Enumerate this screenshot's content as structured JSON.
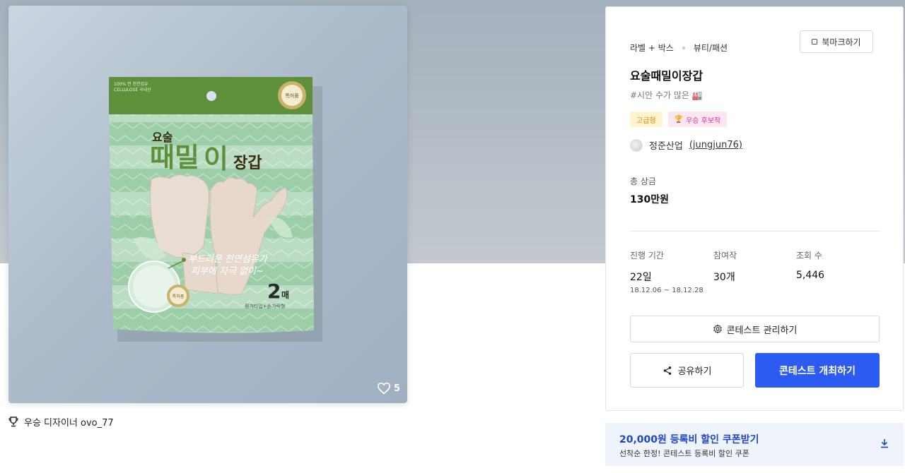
{
  "gallery": {
    "package_texts": {
      "fiber_note": "100% 면 천연섬유",
      "fiber_note_en": "CELLULOSE 국내산",
      "seal": "특허품",
      "brand_small": "요술",
      "brand_big1": "때밀",
      "brand_big2": "이",
      "brand_big3": "장갑",
      "slogan1": "부드러운 천연섬유가",
      "slogan2": "피부에 자극 없이~",
      "count": "2",
      "count_unit": "매",
      "bottom_note": "핑거타입+손가락형"
    },
    "likes": "5",
    "winner_text": "우승 디자이너 ovo_77"
  },
  "contest": {
    "breadcrumb": [
      "라벨 + 박스",
      "뷰티/패션"
    ],
    "bookmark_label": "북마크하기",
    "title": "요술때밀이장갑",
    "tagline": "#시안 수가 많은 🏭",
    "badges": [
      {
        "label": "고급형"
      },
      {
        "label": "우승 후보작"
      }
    ],
    "owner_name": "정준산업",
    "owner_handle": "(jungjun76)",
    "prize_label": "총 상금",
    "prize_value": "130만원",
    "stats": [
      {
        "label": "진행 기간",
        "value": "22일",
        "sub": "18.12.06 ~ 18.12.28"
      },
      {
        "label": "참여작",
        "value": "30개"
      },
      {
        "label": "조회 수",
        "value": "5,446"
      }
    ],
    "manage_label": "콘테스트 관리하기",
    "share_label": "공유하기",
    "host_label": "콘테스트 개최하기"
  },
  "coupon": {
    "title": "20,000원 등록비 할인 쿠폰받기",
    "subtitle": "선착순 한정! 콘테스트 등록비 할인 쿠폰"
  },
  "colors": {
    "primary": "#2b5bf0",
    "coupon_bg": "#eef3fc",
    "package_green": "#5e8f3a"
  }
}
